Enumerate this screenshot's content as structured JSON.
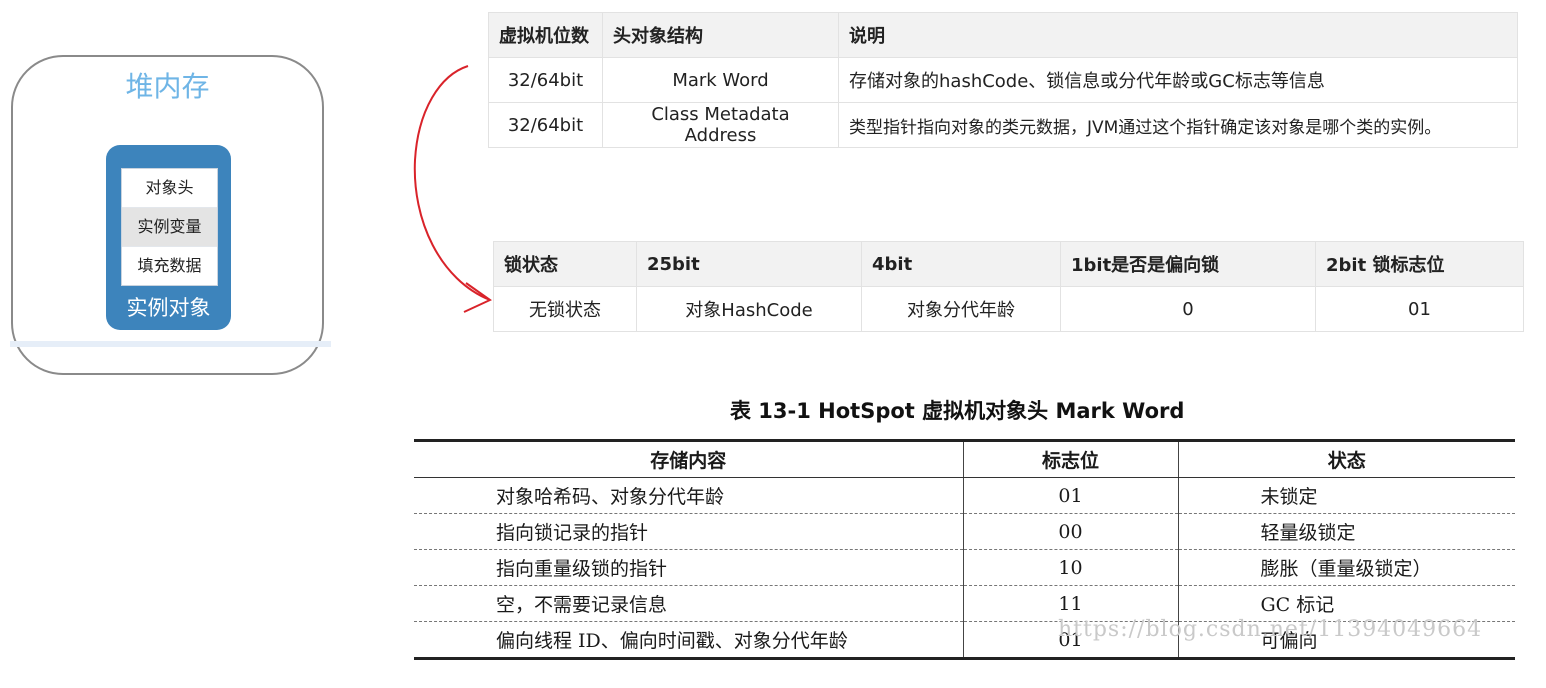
{
  "heap": {
    "title": "堆内存",
    "object_rows": [
      "对象头",
      "实例变量",
      "填充数据"
    ],
    "object_label": "实例对象"
  },
  "header_table": {
    "headers": [
      "虚拟机位数",
      "头对象结构",
      "说明"
    ],
    "rows": [
      [
        "32/64bit",
        "Mark Word",
        "存储对象的hashCode、锁信息或分代年龄或GC标志等信息"
      ],
      [
        "32/64bit",
        "Class Metadata Address",
        "类型指针指向对象的类元数据，JVM通过这个指针确定该对象是哪个类的实例。"
      ]
    ]
  },
  "markword_table": {
    "headers": [
      "锁状态",
      "25bit",
      "4bit",
      "1bit是否是偏向锁",
      "2bit 锁标志位"
    ],
    "row": [
      "无锁状态",
      "对象HashCode",
      "对象分代年龄",
      "0",
      "01"
    ]
  },
  "scan_table": {
    "caption": "表 13-1   HotSpot 虚拟机对象头 Mark Word",
    "headers": [
      "存储内容",
      "标志位",
      "状态"
    ],
    "rows": [
      [
        "对象哈希码、对象分代年龄",
        "01",
        "未锁定"
      ],
      [
        "指向锁记录的指针",
        "00",
        "轻量级锁定"
      ],
      [
        "指向重量级锁的指针",
        "10",
        "膨胀（重量级锁定）"
      ],
      [
        "空，不需要记录信息",
        "11",
        "GC 标记"
      ],
      [
        "偏向线程 ID、偏向时间戳、对象分代年龄",
        "01",
        "可偏向"
      ]
    ],
    "watermark": "https://blog.csdn.net/11394049664"
  },
  "colors": {
    "heap_title": "#6fb5e6",
    "object_card": "#3d84bc",
    "arrow": "#d9232a"
  }
}
